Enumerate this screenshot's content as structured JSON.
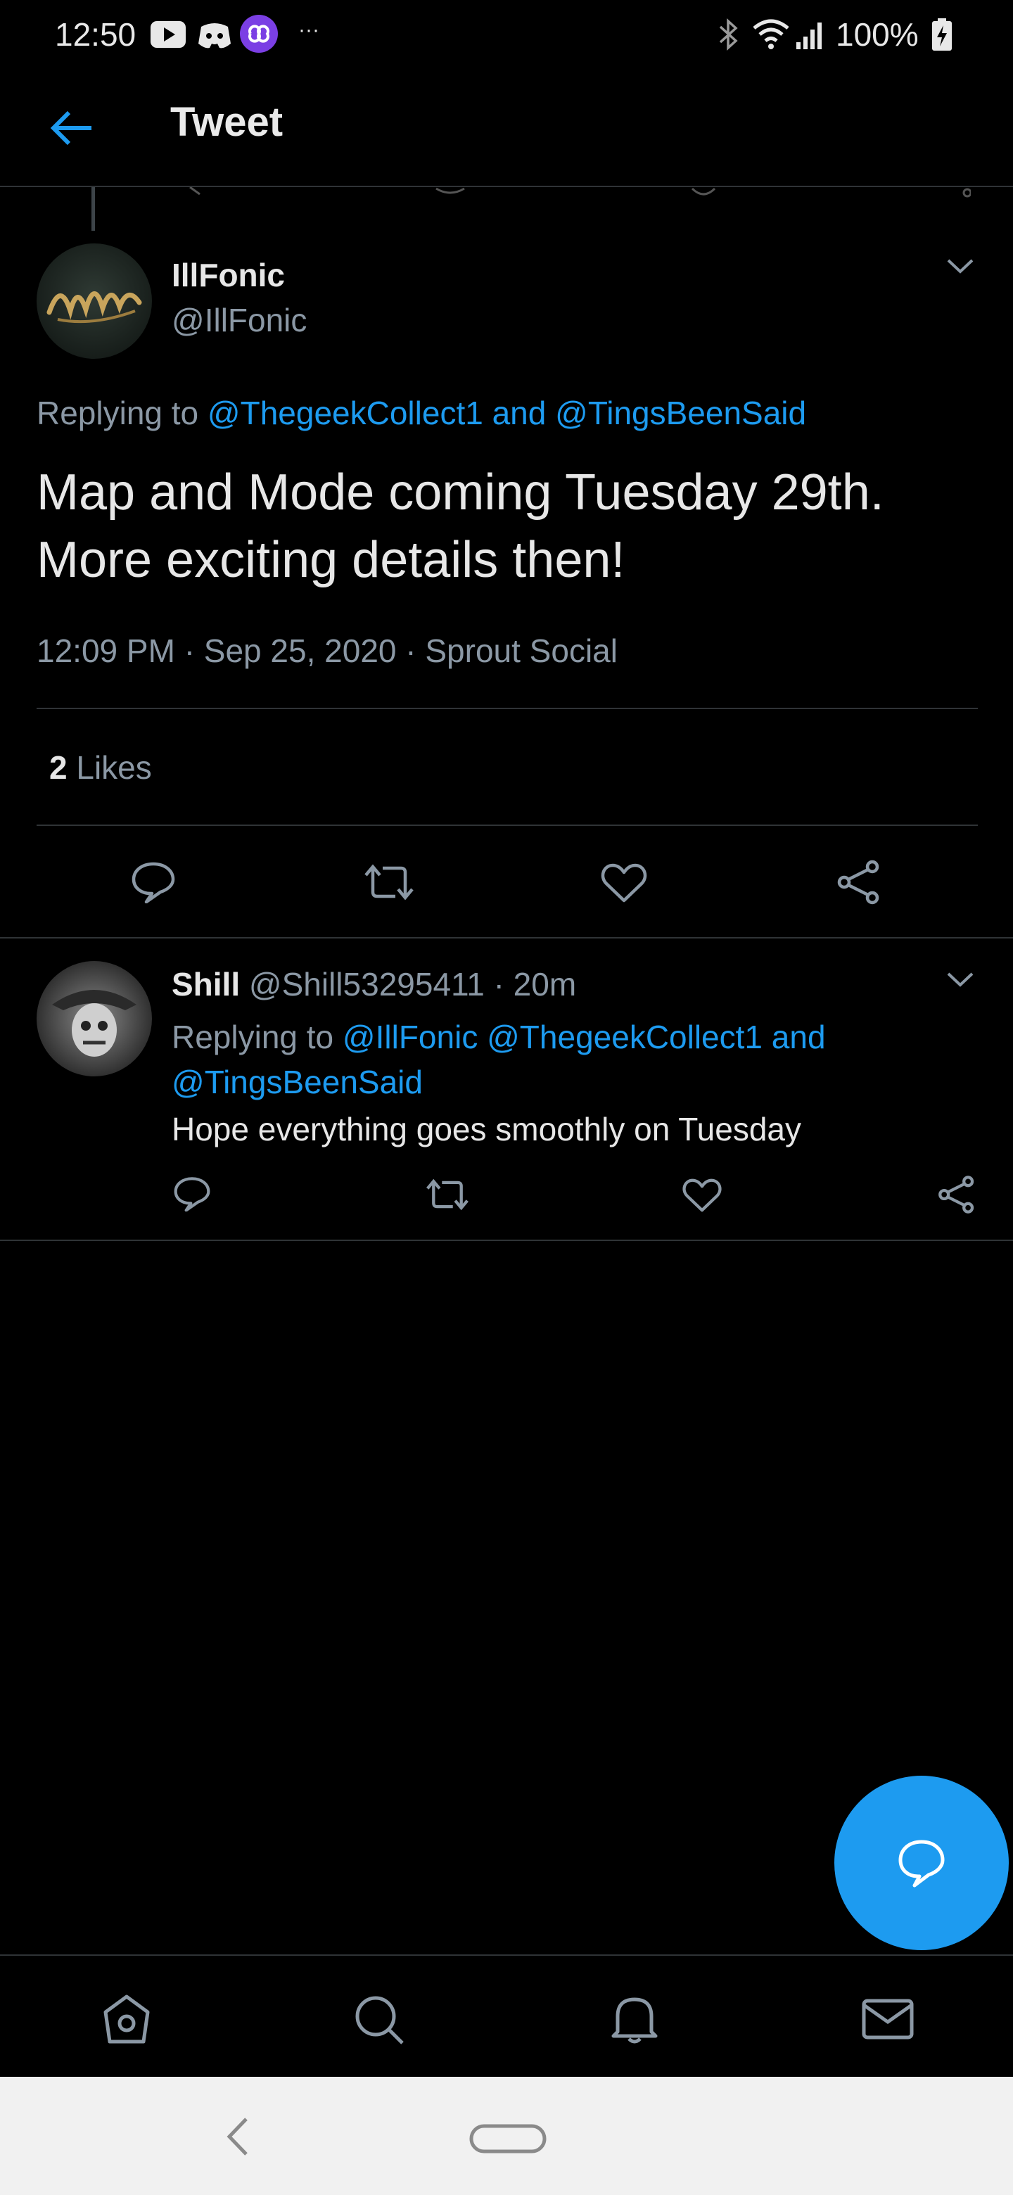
{
  "status_bar": {
    "time": "12:50",
    "battery": "100%",
    "notification_icons": [
      "youtube-icon",
      "discord-icon",
      "app-icon",
      "more-notifications-icon"
    ],
    "right_icons": [
      "bluetooth-icon",
      "wifi-icon",
      "signal-icon",
      "battery-icon"
    ]
  },
  "header": {
    "title": "Tweet",
    "back_icon": "back-arrow-icon"
  },
  "tweet": {
    "author_name": "IllFonic",
    "author_handle": "@IllFonic",
    "replying_prefix": "Replying to",
    "replying_to": "@ThegeekCollect1 and @TingsBeenSaid",
    "text_line1": "Map and Mode coming Tuesday 29th.",
    "text_line2": "More exciting details then!",
    "time": "12:09 PM",
    "date": "Sep 25, 2020",
    "source": "Sprout Social",
    "separator": "·",
    "likes_count": "2",
    "likes_label": "Likes"
  },
  "reply": {
    "author_name": "Shill",
    "author_handle": "@Shill53295411",
    "separator": "·",
    "age": "20m",
    "replying_prefix": "Replying to",
    "replying_to": "@IllFonic @ThegeekCollect1 and @TingsBeenSaid",
    "text": "Hope everything goes smoothly on Tuesday"
  },
  "colors": {
    "accent": "#1d9bf0",
    "background": "#000000",
    "secondary_text": "#8b98a5",
    "divider": "#2f3336"
  },
  "bottom_nav": [
    "home-icon",
    "search-icon",
    "notifications-icon",
    "messages-icon"
  ]
}
